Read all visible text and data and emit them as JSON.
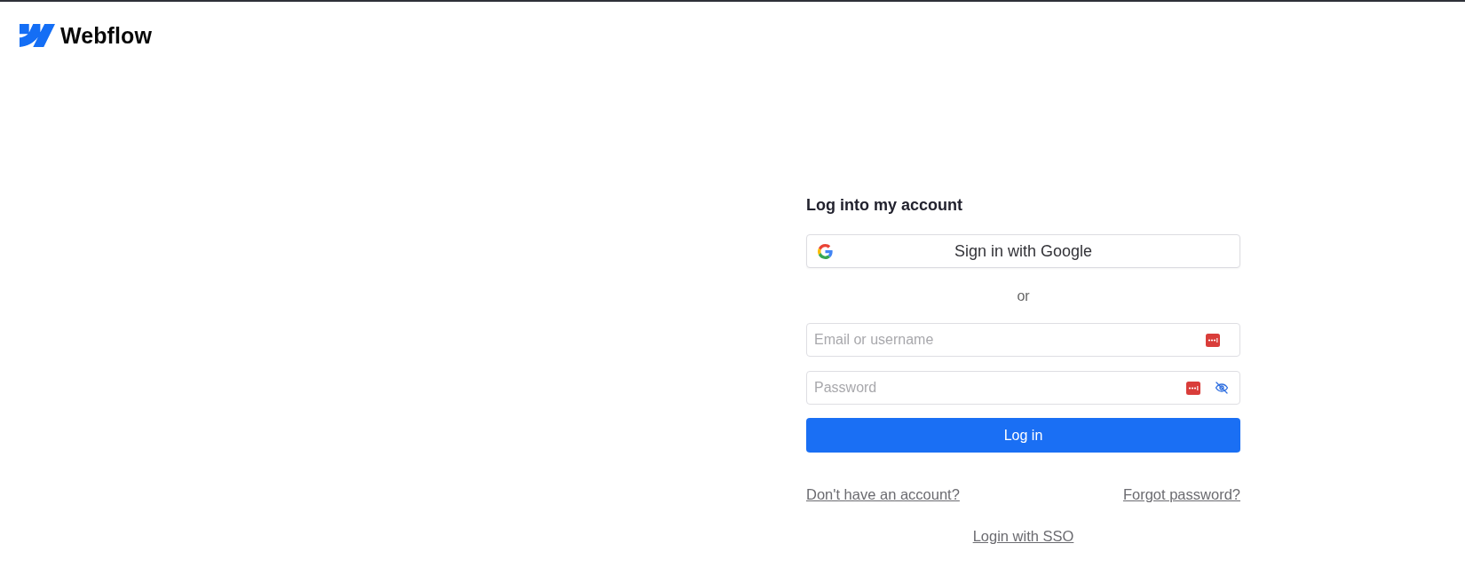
{
  "header": {
    "logo_text": "Webflow"
  },
  "login": {
    "title": "Log into my account",
    "google_button": "Sign in with Google",
    "divider": "or",
    "fields": [
      {
        "kind": "text",
        "placeholder": "Email or username"
      },
      {
        "kind": "password",
        "placeholder": "Password"
      }
    ],
    "submit": "Log in",
    "links": [
      {
        "label": "Don't have an account?"
      },
      {
        "label": "Forgot password?"
      }
    ],
    "sso_link": "Login with SSO"
  }
}
